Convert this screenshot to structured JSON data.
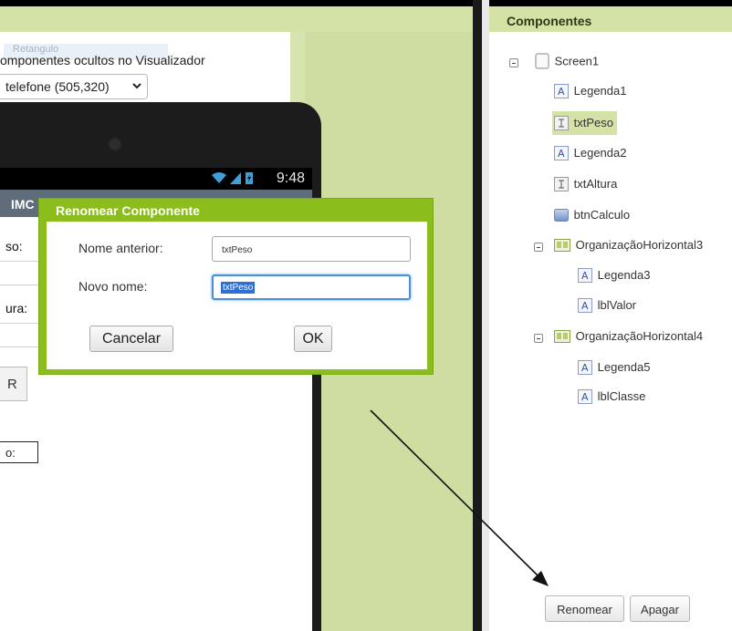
{
  "viewer": {
    "hidden_components_label": "omponentes ocultos no Visualizador",
    "ghost_tooltip": "Retangulo",
    "screen_size": "telefone (505,320)"
  },
  "phone": {
    "time": "9:48",
    "app_title": "IMC",
    "label_weight": "so:",
    "label_height": "ura:",
    "button_text": "R",
    "result_label": "o:"
  },
  "dialog": {
    "title": "Renomear Componente",
    "old_name_label": "Nome anterior:",
    "old_name_value": "txtPeso",
    "new_name_label": "Novo nome:",
    "new_name_value": "txtPeso",
    "cancel_label": "Cancelar",
    "ok_label": "OK"
  },
  "components": {
    "title": "Componentes",
    "tree": [
      {
        "label": "Screen1",
        "icon": "screen-icon"
      },
      {
        "label": "Legenda1",
        "icon": "label-icon"
      },
      {
        "label": "txtPeso",
        "icon": "textbox-icon",
        "selected": true
      },
      {
        "label": "Legenda2",
        "icon": "label-icon"
      },
      {
        "label": "txtAltura",
        "icon": "textbox-icon"
      },
      {
        "label": "btnCalculo",
        "icon": "button-icon"
      },
      {
        "label": "OrganizaçãoHorizontal3",
        "icon": "horizontal-arrangement-icon"
      },
      {
        "label": "Legenda3",
        "icon": "label-icon"
      },
      {
        "label": "lblValor",
        "icon": "label-icon"
      },
      {
        "label": "OrganizaçãoHorizontal4",
        "icon": "horizontal-arrangement-icon"
      },
      {
        "label": "Legenda5",
        "icon": "label-icon"
      },
      {
        "label": "lblClasse",
        "icon": "label-icon"
      }
    ],
    "rename_label": "Renomear",
    "delete_label": "Apagar"
  },
  "colors": {
    "accent_green": "#8bbd1c",
    "header_green": "#d5e2a6",
    "selection_blue": "#2d6fd6"
  }
}
